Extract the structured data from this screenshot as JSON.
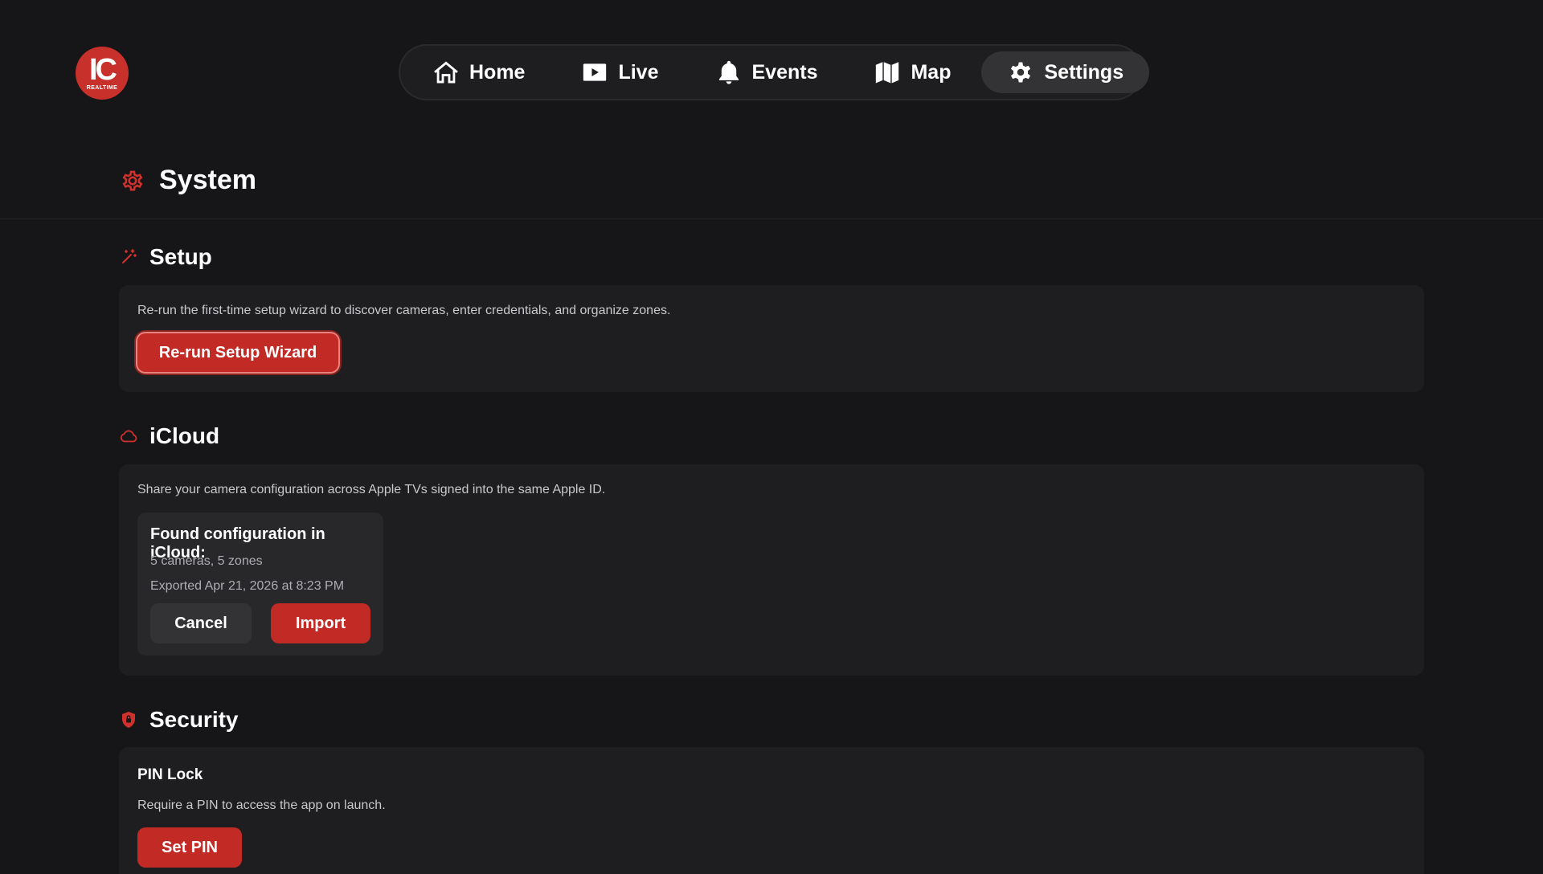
{
  "logo": {
    "mark": "IC",
    "sub": "REALTIME"
  },
  "nav": {
    "items": [
      {
        "label": "Home",
        "icon": "home-icon"
      },
      {
        "label": "Live",
        "icon": "play-icon"
      },
      {
        "label": "Events",
        "icon": "bell-icon"
      },
      {
        "label": "Map",
        "icon": "map-icon"
      },
      {
        "label": "Settings",
        "icon": "gear-icon",
        "active": true
      }
    ]
  },
  "page": {
    "title": "System",
    "icon": "gear-icon"
  },
  "setup": {
    "title": "Setup",
    "icon": "wand-icon",
    "description": "Re-run the first-time setup wizard to discover cameras, enter credentials, and organize zones.",
    "button_label": "Re-run Setup Wizard"
  },
  "icloud": {
    "title": "iCloud",
    "icon": "cloud-icon",
    "description": "Share your camera configuration across Apple TVs signed into the same Apple ID.",
    "found": {
      "title": "Found configuration in iCloud:",
      "summary": "5 cameras, 5 zones",
      "exported": "Exported Apr 21, 2026 at 8:23 PM",
      "cancel_label": "Cancel",
      "import_label": "Import"
    }
  },
  "security": {
    "title": "Security",
    "icon": "shield-icon",
    "pin_title": "PIN Lock",
    "pin_description": "Require a PIN to access the app on launch.",
    "set_pin_label": "Set PIN"
  },
  "colors": {
    "accent": "#c22a26",
    "background": "#161618",
    "card": "#1e1e20"
  }
}
